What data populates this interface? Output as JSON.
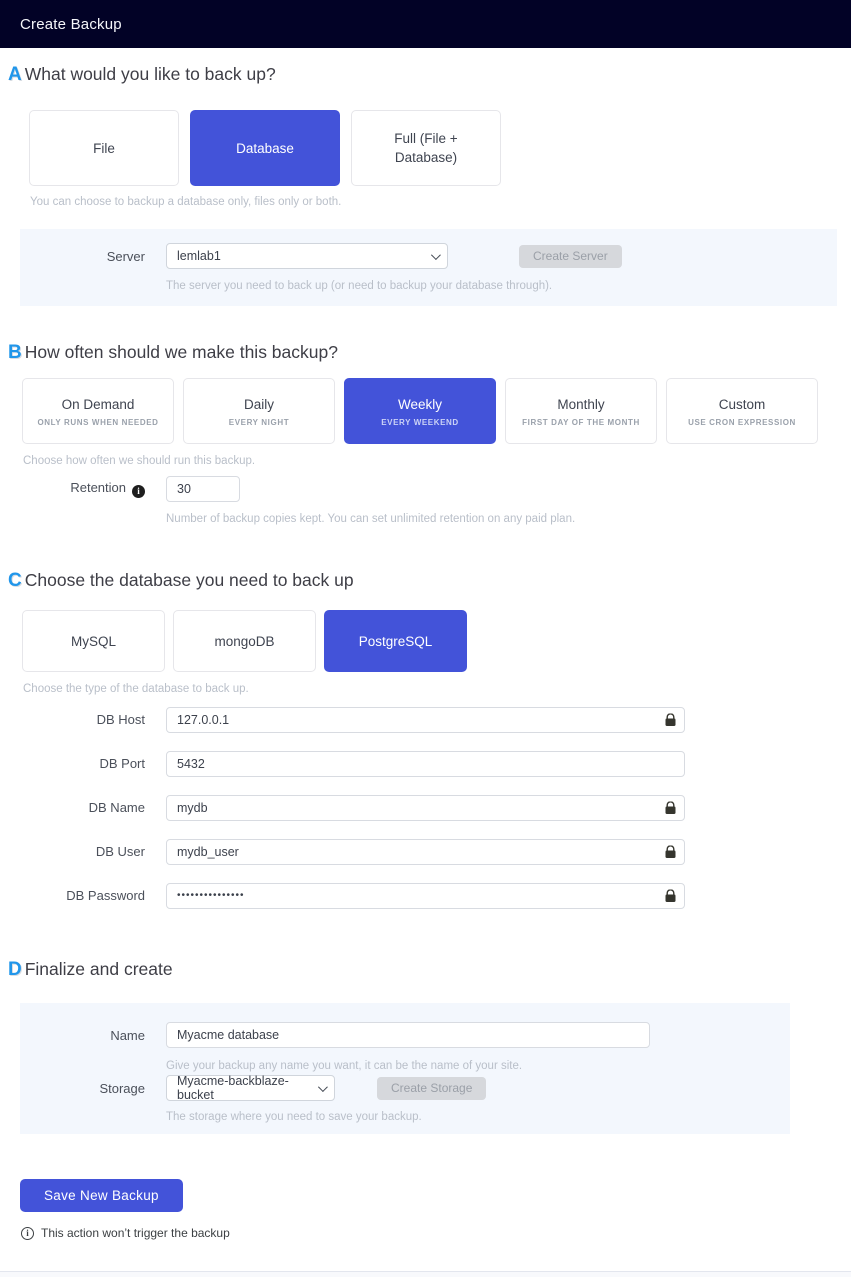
{
  "header": {
    "title": "Create Backup"
  },
  "colors": {
    "accent": "#4353d9",
    "header_bg": "#020226",
    "letter_blue": "#2196ea",
    "panel_bg": "#f3f7fd"
  },
  "sections": {
    "a": {
      "letter": "A",
      "title": "What would you like to back up?",
      "options": [
        {
          "label": "File",
          "selected": false
        },
        {
          "label": "Database",
          "selected": true
        },
        {
          "label": "Full (File + Database)",
          "selected": false
        }
      ],
      "helper": "You can choose to backup a database only, files only or both.",
      "server": {
        "label": "Server",
        "value": "lemlab1",
        "button": "Create Server",
        "helper": "The server you need to back up (or need to backup your database through)."
      }
    },
    "b": {
      "letter": "B",
      "title": "How often should we make this backup?",
      "options": [
        {
          "label": "On Demand",
          "sub": "ONLY RUNS WHEN NEEDED",
          "selected": false
        },
        {
          "label": "Daily",
          "sub": "EVERY NIGHT",
          "selected": false
        },
        {
          "label": "Weekly",
          "sub": "EVERY WEEKEND",
          "selected": true
        },
        {
          "label": "Monthly",
          "sub": "FIRST DAY OF THE MONTH",
          "selected": false
        },
        {
          "label": "Custom",
          "sub": "USE CRON EXPRESSION",
          "selected": false
        }
      ],
      "helper": "Choose how often we should run this backup.",
      "retention": {
        "label": "Retention",
        "value": "30",
        "helper": "Number of backup copies kept. You can set unlimited retention on any paid plan."
      }
    },
    "c": {
      "letter": "C",
      "title": "Choose the database you need to back up",
      "options": [
        {
          "label": "MySQL",
          "selected": false
        },
        {
          "label": "mongoDB",
          "selected": false
        },
        {
          "label": "PostgreSQL",
          "selected": true
        }
      ],
      "helper": "Choose the type of the database to back up.",
      "fields": [
        {
          "label": "DB Host",
          "value": "127.0.0.1"
        },
        {
          "label": "DB Port",
          "value": "5432"
        },
        {
          "label": "DB Name",
          "value": "mydb"
        },
        {
          "label": "DB User",
          "value": "mydb_user"
        },
        {
          "label": "DB Password",
          "value": "•••••••••••••••"
        }
      ]
    },
    "d": {
      "letter": "D",
      "title": "Finalize and create",
      "name": {
        "label": "Name",
        "value": "Myacme database",
        "helper": "Give your backup any name you want, it can be the name of your site."
      },
      "storage": {
        "label": "Storage",
        "value": "Myacme-backblaze-bucket",
        "button": "Create Storage",
        "helper": "The storage where you need to save your backup."
      }
    }
  },
  "footer": {
    "save_button": "Save New Backup",
    "note": "This action won’t trigger the backup"
  }
}
